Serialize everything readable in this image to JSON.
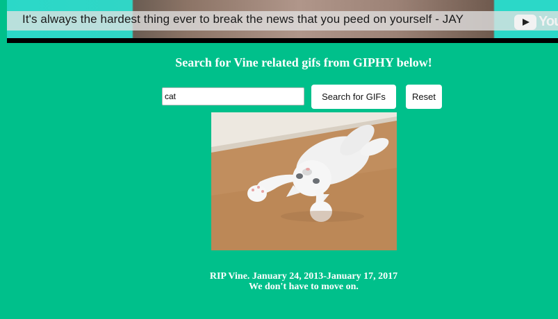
{
  "video": {
    "caption": "It's always the hardest thing ever to break the news that you peed on yourself - JAY",
    "yt_word": "You",
    "icon": "youtube-logo-icon"
  },
  "heading": "Search for Vine related gifs from GIPHY below!",
  "search": {
    "value": "cat",
    "placeholder": ""
  },
  "buttons": {
    "search_label": "Search for GIFs",
    "reset_label": "Reset"
  },
  "gif": {
    "subject": "white kitten lying on back"
  },
  "footer": {
    "line1": "RIP Vine. January 24, 2013-January 17, 2017",
    "line2": "We don't have to move on."
  },
  "colors": {
    "background": "#00c08b",
    "button": "#ffffff",
    "text": "#ffffff"
  }
}
